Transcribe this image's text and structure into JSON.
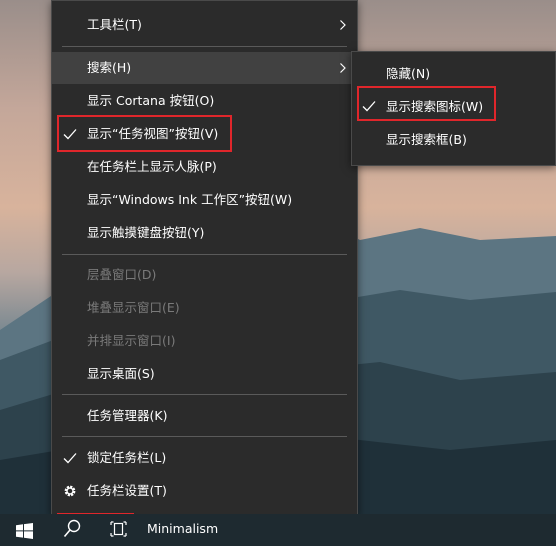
{
  "main_menu": {
    "items": [
      {
        "label": "工具栏(T)"
      },
      {
        "label": "搜索(H)"
      },
      {
        "label": "显示 Cortana 按钮(O)"
      },
      {
        "label": "显示“任务视图”按钮(V)"
      },
      {
        "label": "在任务栏上显示人脉(P)"
      },
      {
        "label": "显示“Windows Ink 工作区”按钮(W)"
      },
      {
        "label": "显示触摸键盘按钮(Y)"
      },
      {
        "label": "层叠窗口(D)"
      },
      {
        "label": "堆叠显示窗口(E)"
      },
      {
        "label": "并排显示窗口(I)"
      },
      {
        "label": "显示桌面(S)"
      },
      {
        "label": "任务管理器(K)"
      },
      {
        "label": "锁定任务栏(L)"
      },
      {
        "label": "任务栏设置(T)"
      }
    ]
  },
  "sub_menu": {
    "items": [
      {
        "label": "隐藏(N)"
      },
      {
        "label": "显示搜索图标(W)"
      },
      {
        "label": "显示搜索框(B)"
      }
    ]
  },
  "taskbar": {
    "app_label": "Minimalism"
  },
  "colors": {
    "menu_bg": "#2b2b2b",
    "highlight_box": "#e0262b",
    "disabled_text": "#7a7a7a"
  },
  "icons": [
    "chevron-right-icon",
    "check-icon",
    "gear-icon",
    "windows-logo-icon",
    "search-icon",
    "task-view-icon"
  ]
}
